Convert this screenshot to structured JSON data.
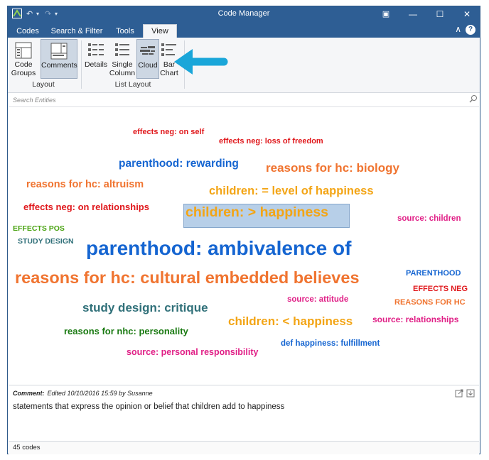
{
  "window": {
    "title": "Code Manager",
    "controls": [
      "▣",
      "—",
      "☐",
      "✕"
    ]
  },
  "tabs": [
    {
      "label": "Codes",
      "active": false
    },
    {
      "label": "Search & Filter",
      "active": false
    },
    {
      "label": "Tools",
      "active": false
    },
    {
      "label": "View",
      "active": true
    }
  ],
  "ribbon": {
    "layout_group": {
      "label": "Layout",
      "buttons": [
        {
          "label": "Code\nGroups",
          "icon": "code-groups-icon"
        },
        {
          "label": "Comments",
          "icon": "comments-icon",
          "pressed": true
        }
      ]
    },
    "list_layout_group": {
      "label": "List Layout",
      "buttons": [
        {
          "label": "Details",
          "icon": "details-icon"
        },
        {
          "label": "Single\nColumn",
          "icon": "single-column-icon"
        },
        {
          "label": "Cloud",
          "icon": "cloud-icon",
          "pressed": true
        },
        {
          "label": "Bar\nChart",
          "icon": "bar-chart-icon"
        }
      ]
    }
  },
  "search": {
    "placeholder": "Search Entities"
  },
  "cloud": {
    "words": [
      {
        "text": "effects neg: on self",
        "color": "#e0171b"
      },
      {
        "text": "effects neg: loss of freedom",
        "color": "#e0171b"
      },
      {
        "text": "parenthood: rewarding",
        "color": "#1565d1"
      },
      {
        "text": "reasons for hc: biology",
        "color": "#f07430"
      },
      {
        "text": "reasons for hc: altruism",
        "color": "#f07430"
      },
      {
        "text": "children: = level of happiness",
        "color": "#f3a516"
      },
      {
        "text": "effects neg: on relationships",
        "color": "#e0171b"
      },
      {
        "text": "children: > happiness",
        "color": "#f3a516",
        "selected": true
      },
      {
        "text": "source: children",
        "color": "#e01f86"
      },
      {
        "text": "EFFECTS POS",
        "color": "#4aa312"
      },
      {
        "text": "STUDY DESIGN",
        "color": "#307079"
      },
      {
        "text": "parenthood: ambivalence of",
        "color": "#1565d1"
      },
      {
        "text": "reasons for hc: cultural embedded believes",
        "color": "#f07430"
      },
      {
        "text": "PARENTHOOD",
        "color": "#1565d1"
      },
      {
        "text": "EFFECTS NEG",
        "color": "#e0171b"
      },
      {
        "text": "source: attitude",
        "color": "#e01f86"
      },
      {
        "text": "REASONS FOR HC",
        "color": "#f07430"
      },
      {
        "text": "study design: critique",
        "color": "#307079"
      },
      {
        "text": "children: < happiness",
        "color": "#f3a516"
      },
      {
        "text": "source: relationships",
        "color": "#e01f86"
      },
      {
        "text": "reasons for nhc: personality",
        "color": "#1a7a12"
      },
      {
        "text": "def happiness: fulfillment",
        "color": "#1565d1"
      },
      {
        "text": "source: personal responsibility",
        "color": "#e01f86"
      }
    ]
  },
  "comment": {
    "label": "Comment:",
    "meta": "Edited 10/10/2016 15:59 by Susanne",
    "text": "statements that express the opinion or belief that children add to happiness"
  },
  "status": {
    "count": "45 codes"
  },
  "colors": {
    "titlebar": "#2e5e94",
    "annotation_arrow": "#1aa6d9",
    "selection": "#b7cfe8"
  }
}
